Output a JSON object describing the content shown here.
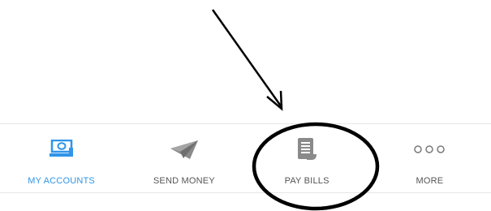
{
  "tabbar": {
    "active_color": "#2f95e8",
    "inactive_color": "#555555",
    "icon_gray": "#8a8a8a",
    "items": [
      {
        "label": "MY ACCOUNTS",
        "icon": "money-icon",
        "active": true
      },
      {
        "label": "SEND MONEY",
        "icon": "paper-plane-icon",
        "active": false
      },
      {
        "label": "PAY BILLS",
        "icon": "bill-icon",
        "active": false
      },
      {
        "label": "MORE",
        "icon": "more-dots-icon",
        "active": false
      }
    ]
  },
  "annotation": {
    "arrow": "arrow-pointing-to-pay-bills",
    "circle": "circle-around-pay-bills",
    "color": "#000000"
  }
}
